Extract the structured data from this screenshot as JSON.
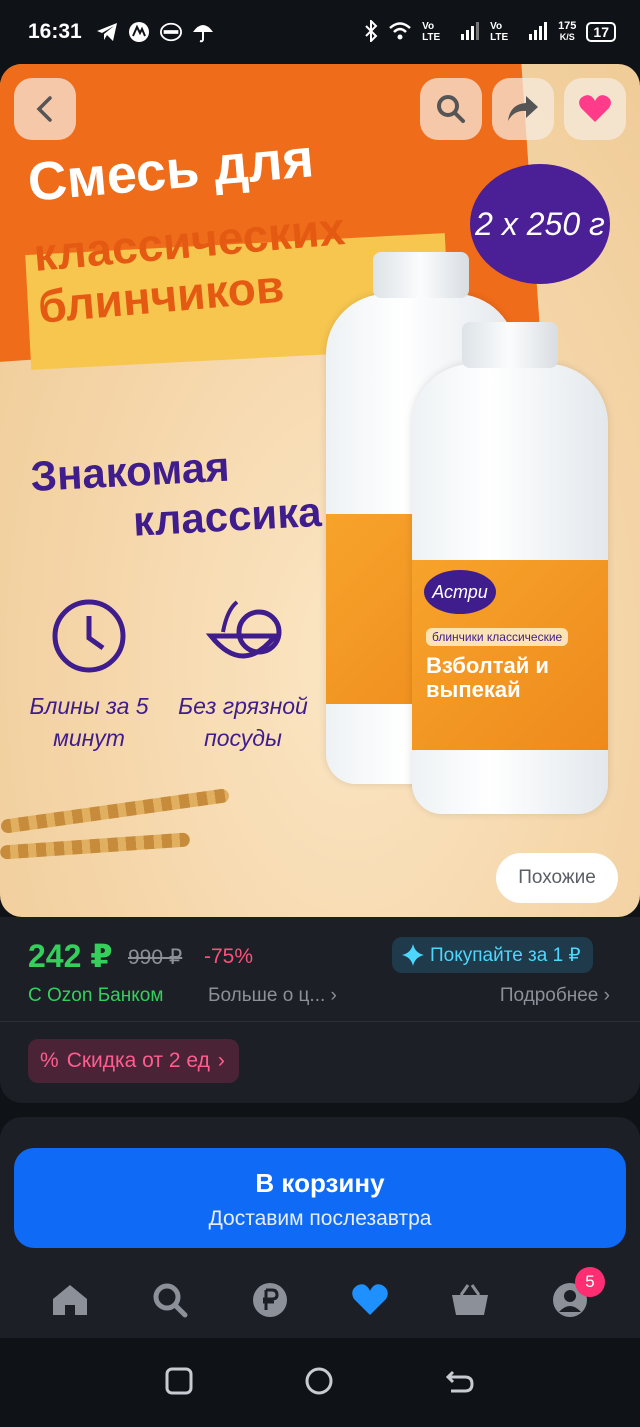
{
  "status_bar": {
    "time": "16:31",
    "net_speed_value": "175",
    "net_speed_unit": "K/S",
    "network_1": "Vo LTE",
    "network_2": "Vo LTE",
    "battery": "17"
  },
  "hero": {
    "headline_1": "Смесь для",
    "headline_2": "классических",
    "headline_3": "блинчиков",
    "weight": "2 x 250 г",
    "slogan_1": "Знакомая",
    "slogan_2": "классика",
    "feature_1": "Блины за 5 минут",
    "feature_2": "Без грязной посуды",
    "brand": "Астри",
    "bottle_label": "Взболтай и выпекай",
    "bottle_sublabel": "блинчики классические",
    "similar_button": "Похожие"
  },
  "price": {
    "current": "242 ₽",
    "old": "990 ₽",
    "discount": "-75%",
    "promo": "Покупайте за 1 ₽",
    "ozon_bank": "С Ozon Банком",
    "more": "Больше о ц...",
    "details": "Подробнее",
    "bulk_discount": "Скидка от 2 ед"
  },
  "cart": {
    "label": "В корзину",
    "delivery": "Доставим послезавтра"
  },
  "bottom_nav": {
    "cart_badge": "5"
  },
  "colors": {
    "accent_green": "#35d05b",
    "accent_blue": "#0f6bf5",
    "accent_pink": "#ff4f7a",
    "brand_purple": "#3f1d8c",
    "orange": "#ef6c1a"
  }
}
